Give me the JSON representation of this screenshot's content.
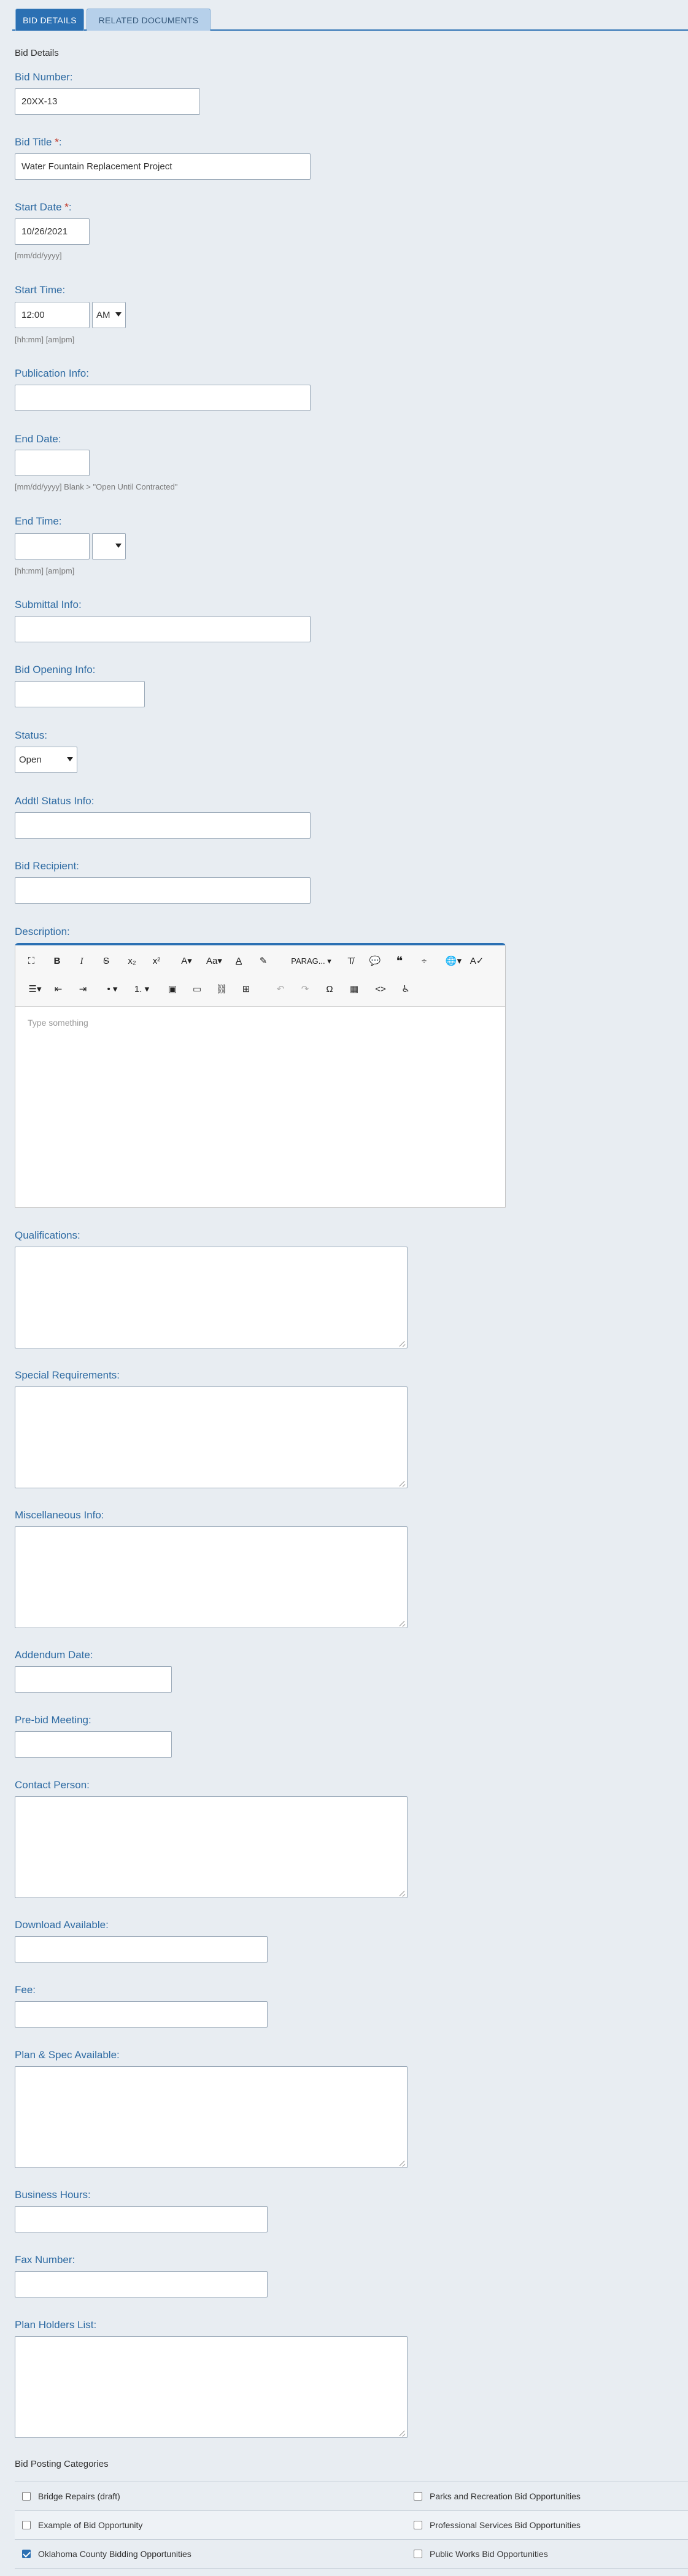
{
  "tabs": [
    {
      "label": "BID DETAILS"
    },
    {
      "label": "RELATED DOCUMENTS"
    }
  ],
  "section_title": "Bid Details",
  "fields": {
    "bid_number": {
      "label": "Bid Number:",
      "value": "20XX-13"
    },
    "bid_title": {
      "label": "Bid Title",
      "required_mark": "*",
      "suffix": ":",
      "value": "Water Fountain Replacement Project"
    },
    "start_date": {
      "label": "Start Date",
      "required_mark": "*",
      "suffix": ":",
      "value": "10/26/2021",
      "hint": "[mm/dd/yyyy]"
    },
    "start_time": {
      "label": "Start Time:",
      "value": "12:00",
      "ampm": "AM",
      "hint": "[hh:mm] [am|pm]"
    },
    "publication_info": {
      "label": "Publication Info:",
      "value": ""
    },
    "end_date": {
      "label": "End Date:",
      "value": "",
      "hint": "[mm/dd/yyyy] Blank > \"Open Until Contracted\""
    },
    "end_time": {
      "label": "End Time:",
      "value": "",
      "ampm": "",
      "hint": "[hh:mm] [am|pm]"
    },
    "submittal_info": {
      "label": "Submittal Info:",
      "value": ""
    },
    "bid_opening_info": {
      "label": "Bid Opening Info:",
      "value": ""
    },
    "status": {
      "label": "Status:",
      "value": "Open"
    },
    "addtl_status_info": {
      "label": "Addtl Status Info:",
      "value": ""
    },
    "bid_recipient": {
      "label": "Bid Recipient:",
      "value": ""
    },
    "description": {
      "label": "Description:",
      "placeholder": "Type something"
    },
    "qualifications": {
      "label": "Qualifications:"
    },
    "special_requirements": {
      "label": "Special Requirements:"
    },
    "miscellaneous_info": {
      "label": "Miscellaneous Info:"
    },
    "addendum_date": {
      "label": "Addendum Date:",
      "value": ""
    },
    "pre_bid_meeting": {
      "label": "Pre-bid Meeting:",
      "value": ""
    },
    "contact_person": {
      "label": "Contact Person:"
    },
    "download_available": {
      "label": "Download Available:",
      "value": ""
    },
    "fee": {
      "label": "Fee:",
      "value": ""
    },
    "plan_spec_available": {
      "label": "Plan & Spec Available:"
    },
    "business_hours": {
      "label": "Business Hours:",
      "value": ""
    },
    "fax_number": {
      "label": "Fax Number:",
      "value": ""
    },
    "plan_holders_list": {
      "label": "Plan Holders List:"
    }
  },
  "editor_toolbar": {
    "paragraph_label": "PARAG..."
  },
  "categories": {
    "title": "Bid Posting Categories",
    "rows": [
      [
        {
          "label": "Bridge Repairs (draft)",
          "checked": false
        },
        {
          "label": "Parks and Recreation Bid Opportunities",
          "checked": false
        }
      ],
      [
        {
          "label": "Example of Bid Opportunity",
          "checked": false
        },
        {
          "label": "Professional Services Bid Opportunities",
          "checked": false
        }
      ],
      [
        {
          "label": "Oklahoma County Bidding Opportunities",
          "checked": true
        },
        {
          "label": "Public Works Bid Opportunities",
          "checked": false
        }
      ]
    ]
  },
  "colors": {
    "accent": "#2b70b3",
    "label": "#2d6aa2",
    "required": "#c0392b",
    "background": "#e8edf2"
  }
}
